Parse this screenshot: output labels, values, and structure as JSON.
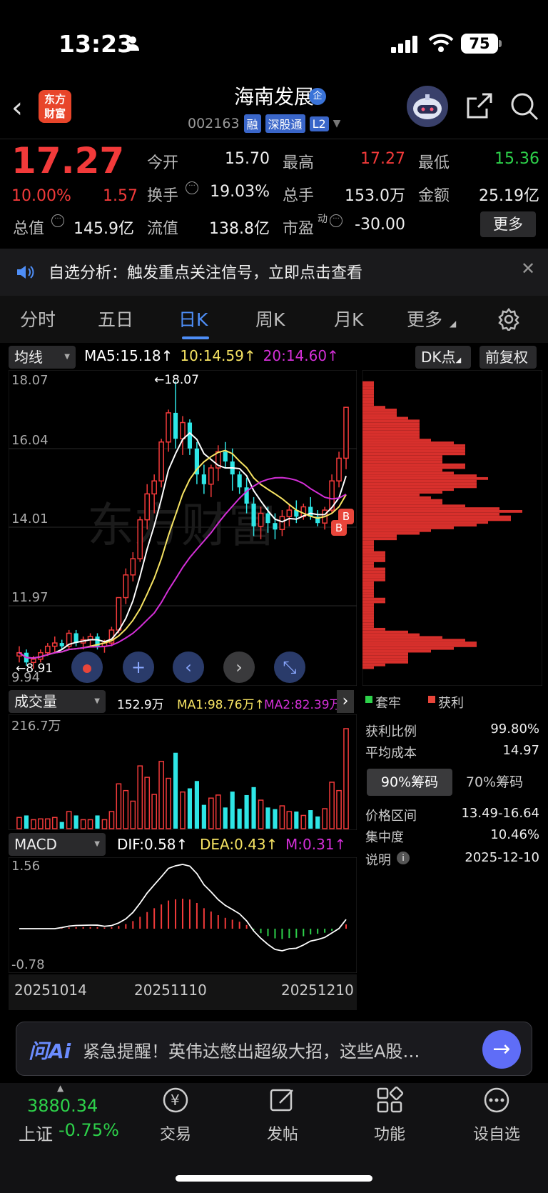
{
  "status_bar": {
    "time": "13:23",
    "battery": "75"
  },
  "header": {
    "logo_line1": "东方",
    "logo_line2": "财富",
    "stock_name": "海南发展",
    "corp_badge": "企",
    "code": "002163",
    "tags": [
      "融",
      "深股通",
      "L2"
    ]
  },
  "quote": {
    "price": "17.27",
    "change_pct": "10.00%",
    "change": "1.57",
    "open_label": "今开",
    "open": "15.70",
    "high_label": "最高",
    "high": "17.27",
    "low_label": "最低",
    "low": "15.36",
    "turnover_label": "换手",
    "turnover": "19.03%",
    "volume_label": "总手",
    "volume": "153.0万",
    "amount_label": "金额",
    "amount": "25.19亿",
    "mktcap_label": "总值",
    "mktcap": "145.9亿",
    "float_label": "流值",
    "float": "138.8亿",
    "pe_label": "市盈",
    "pe_sup": "动",
    "pe": "-30.00",
    "more": "更多"
  },
  "notice": {
    "text": "自选分析：触发重点关注信号，立即点击查看"
  },
  "tabs": [
    "分时",
    "五日",
    "日K",
    "周K",
    "月K",
    "更多"
  ],
  "active_tab": "日K",
  "kline": {
    "indicator_select": "均线",
    "ma5": "MA5:15.18↑",
    "ma10": "10:14.59↑",
    "ma20": "20:14.60↑",
    "dk_button": "DK点",
    "fq_button": "前复权",
    "y_labels": [
      "18.07",
      "16.04",
      "14.01",
      "11.97",
      "9.94"
    ],
    "max_marker": "←18.07",
    "min_marker": "←8.91",
    "b_marker": "B",
    "watermark": "东方财富"
  },
  "volume": {
    "select": "成交量",
    "value": "152.9万",
    "ma1": "MA1:98.76万↑",
    "ma2": "MA2:82.39万↑",
    "y_max": "216.7万"
  },
  "macd": {
    "select": "MACD",
    "dif": "DIF:0.58↑",
    "dea": "DEA:0.43↑",
    "m": "M:0.31↑",
    "y_top": "1.56",
    "y_bottom": "-0.78"
  },
  "x_dates": [
    "20251014",
    "20251110",
    "20251210"
  ],
  "chips": {
    "legend_trapped": "套牢",
    "legend_profit": "获利",
    "rows": [
      [
        "获利比例",
        "99.80%"
      ],
      [
        "平均成本",
        "14.97"
      ]
    ],
    "tab_90": "90%筹码",
    "tab_70": "70%筹码",
    "rows2": [
      [
        "价格区间",
        "13.49-16.64"
      ],
      [
        "集中度",
        "10.46%"
      ],
      [
        "说明",
        "2025-12-10"
      ]
    ]
  },
  "ask": {
    "logo": "问Ai",
    "text": "紧急提醒！英伟达憋出超级大招，这些A股…"
  },
  "bottom": {
    "index_value": "3880.34",
    "index_name": "上证",
    "index_change": "-0.75%",
    "nav": [
      "交易",
      "发帖",
      "功能",
      "设自选"
    ]
  },
  "colors": {
    "up": "#f23a3a",
    "down": "#2ee6e6",
    "ma5": "#ffffff",
    "ma10": "#f7e463",
    "ma20": "#d42fd8",
    "accent": "#4e8ef7"
  },
  "chart_data": {
    "type": "candlestick",
    "ylim": [
      8.9,
      18.2
    ],
    "candles": [
      [
        9.6,
        9.9,
        9.4,
        9.7
      ],
      [
        9.7,
        9.8,
        9.3,
        9.4
      ],
      [
        9.4,
        9.6,
        9.2,
        9.5
      ],
      [
        9.5,
        9.8,
        9.4,
        9.7
      ],
      [
        9.7,
        10.0,
        9.6,
        9.9
      ],
      [
        9.9,
        10.2,
        9.7,
        10.0
      ],
      [
        10.0,
        10.1,
        9.8,
        9.9
      ],
      [
        9.9,
        10.4,
        9.8,
        10.3
      ],
      [
        10.3,
        10.4,
        9.9,
        10.0
      ],
      [
        10.0,
        10.2,
        9.8,
        10.1
      ],
      [
        10.1,
        10.3,
        9.9,
        10.2
      ],
      [
        10.2,
        10.3,
        9.8,
        9.9
      ],
      [
        9.9,
        10.1,
        9.7,
        10.0
      ],
      [
        10.0,
        10.5,
        9.9,
        10.4
      ],
      [
        10.4,
        11.4,
        10.3,
        11.4
      ],
      [
        11.4,
        12.3,
        11.2,
        12.1
      ],
      [
        12.1,
        12.8,
        11.9,
        12.6
      ],
      [
        12.6,
        13.9,
        12.5,
        13.8
      ],
      [
        13.8,
        14.9,
        13.5,
        14.6
      ],
      [
        14.6,
        15.2,
        14.0,
        15.0
      ],
      [
        15.0,
        16.3,
        14.8,
        16.2
      ],
      [
        16.2,
        17.2,
        15.9,
        17.1
      ],
      [
        17.1,
        18.07,
        16.0,
        16.3
      ],
      [
        16.3,
        17.0,
        15.8,
        16.8
      ],
      [
        16.8,
        16.9,
        15.8,
        16.0
      ],
      [
        16.0,
        16.2,
        14.9,
        15.2
      ],
      [
        15.2,
        15.5,
        14.6,
        14.9
      ],
      [
        14.9,
        15.5,
        14.5,
        15.4
      ],
      [
        15.4,
        16.1,
        15.0,
        15.9
      ],
      [
        15.9,
        16.2,
        15.4,
        15.6
      ],
      [
        15.6,
        16.0,
        14.7,
        15.2
      ],
      [
        15.2,
        15.3,
        14.6,
        14.8
      ],
      [
        14.8,
        15.1,
        14.0,
        14.3
      ],
      [
        14.3,
        14.5,
        13.3,
        13.6
      ],
      [
        13.6,
        14.2,
        13.2,
        14.0
      ],
      [
        14.0,
        14.2,
        13.4,
        13.7
      ],
      [
        13.7,
        14.0,
        13.2,
        13.5
      ],
      [
        13.5,
        14.1,
        13.3,
        13.9
      ],
      [
        13.9,
        14.3,
        13.6,
        14.1
      ],
      [
        14.1,
        14.4,
        13.7,
        13.9
      ],
      [
        13.9,
        14.3,
        13.8,
        14.2
      ],
      [
        14.2,
        14.5,
        13.8,
        13.9
      ],
      [
        13.9,
        14.1,
        13.6,
        13.7
      ],
      [
        13.7,
        14.2,
        13.5,
        14.1
      ],
      [
        14.1,
        15.2,
        14.0,
        15.0
      ],
      [
        15.0,
        15.9,
        14.8,
        15.7
      ],
      [
        15.7,
        17.27,
        15.36,
        17.27
      ]
    ]
  }
}
